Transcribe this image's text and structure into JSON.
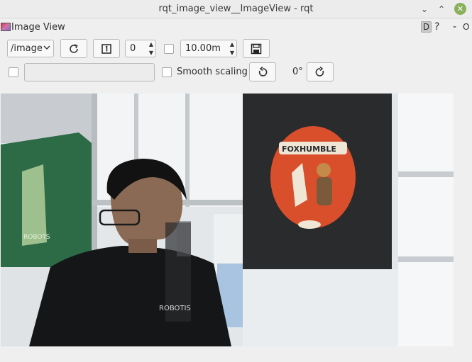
{
  "window": {
    "title": "rqt_image_view__ImageView - rqt",
    "close_glyph": "✕",
    "min_glyph": "⌄",
    "max_glyph": "⌃"
  },
  "plugin": {
    "title": "Image View",
    "d_label": "D",
    "help_label": "?",
    "minus_label": "-",
    "o_label": "O"
  },
  "toolbar": {
    "topic": "/image",
    "frame_value": "0",
    "timeout_value": "10.00m",
    "smooth_label": "Smooth scaling",
    "rotation_label": "0°",
    "topic_text_value": ""
  },
  "icons": {
    "refresh": "refresh-icon",
    "fit": "fit-icon",
    "save": "save-icon",
    "rotate_left": "rotate-left-icon",
    "rotate_right": "rotate-right-icon"
  },
  "image": {
    "shirt_text": "ROBOTIS"
  }
}
